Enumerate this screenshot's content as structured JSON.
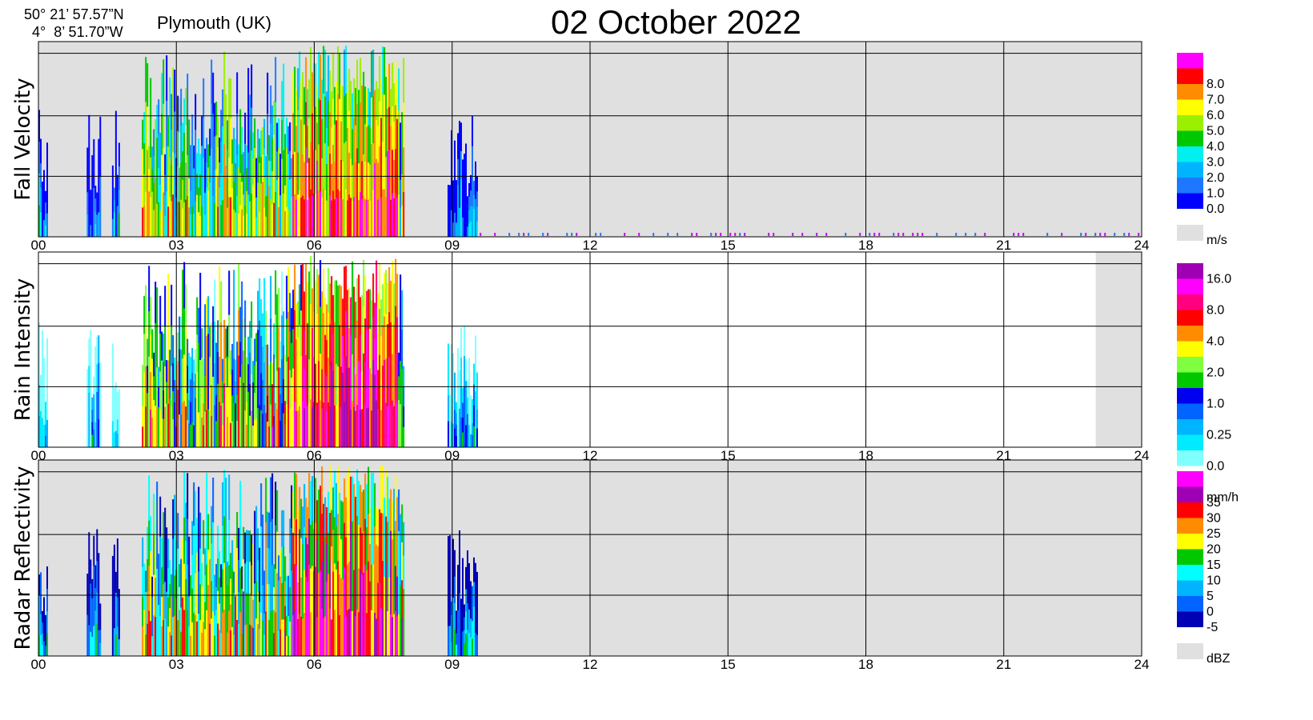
{
  "header": {
    "latitude": "50° 21’ 57.57”N",
    "longitude": "4°  8’ 51.70”W",
    "location": "Plymouth (UK)",
    "date": "02 October  2022"
  },
  "chart_data": [
    {
      "type": "heatmap",
      "ylabel": "Fall Velocity",
      "x_ticks": [
        "00",
        "03",
        "06",
        "09",
        "12",
        "15",
        "18",
        "21",
        "24"
      ],
      "xlim": [
        0,
        24
      ],
      "unit": "m/s",
      "colorbar": [
        {
          "label": "0.0",
          "color": "#0000ff"
        },
        {
          "label": "1.0",
          "color": "#1e78ff"
        },
        {
          "label": "2.0",
          "color": "#00b4ff"
        },
        {
          "label": "3.0",
          "color": "#00f0f0"
        },
        {
          "label": "4.0",
          "color": "#00c800"
        },
        {
          "label": "5.0",
          "color": "#9bef00"
        },
        {
          "label": "6.0",
          "color": "#ffff00"
        },
        {
          "label": "7.0",
          "color": "#ff8c00"
        },
        {
          "label": "8.0",
          "color": "#ff0000"
        },
        {
          "label": "",
          "color": "#ff00ff"
        }
      ],
      "rain_periods_hours": [
        [
          0.0,
          0.2
        ],
        [
          1.05,
          1.35
        ],
        [
          1.6,
          1.75
        ],
        [
          2.25,
          7.95
        ],
        [
          8.9,
          9.55
        ]
      ],
      "no_data_periods_hours": []
    },
    {
      "type": "heatmap",
      "ylabel": "Rain Intensity",
      "x_ticks": [
        "00",
        "03",
        "06",
        "09",
        "12",
        "15",
        "18",
        "21",
        "24"
      ],
      "xlim": [
        0,
        24
      ],
      "unit": "mm/h",
      "colorbar": [
        {
          "label": "0.0",
          "color": "#80ffff"
        },
        {
          "label": "",
          "color": "#00ebff"
        },
        {
          "label": "0.25",
          "color": "#00b4ff"
        },
        {
          "label": "",
          "color": "#0064ff"
        },
        {
          "label": "1.0",
          "color": "#0000f0"
        },
        {
          "label": "",
          "color": "#00c800"
        },
        {
          "label": "2.0",
          "color": "#80ff40"
        },
        {
          "label": "",
          "color": "#ffff00"
        },
        {
          "label": "4.0",
          "color": "#ff8c00"
        },
        {
          "label": "",
          "color": "#ff0000"
        },
        {
          "label": "8.0",
          "color": "#ff0080"
        },
        {
          "label": "",
          "color": "#ff00ff"
        },
        {
          "label": "16.0",
          "color": "#a000b4"
        }
      ],
      "rain_periods_hours": [
        [
          0.0,
          0.2
        ],
        [
          1.05,
          1.35
        ],
        [
          1.6,
          1.75
        ],
        [
          2.25,
          7.95
        ],
        [
          8.9,
          9.55
        ]
      ],
      "no_data_periods_hours": [
        [
          23.0,
          24.0
        ]
      ]
    },
    {
      "type": "heatmap",
      "ylabel": "Radar Reflectivity",
      "x_ticks": [
        "00",
        "03",
        "06",
        "09",
        "12",
        "15",
        "18",
        "21",
        "24"
      ],
      "xlim": [
        0,
        24
      ],
      "unit": "dBZ",
      "colorbar": [
        {
          "label": "-5",
          "color": "#0000b4"
        },
        {
          "label": "0",
          "color": "#0064ff"
        },
        {
          "label": "5",
          "color": "#00b4ff"
        },
        {
          "label": "10",
          "color": "#00ffff"
        },
        {
          "label": "15",
          "color": "#00c800"
        },
        {
          "label": "20",
          "color": "#ffff00"
        },
        {
          "label": "25",
          "color": "#ff8c00"
        },
        {
          "label": "30",
          "color": "#ff0000"
        },
        {
          "label": "35",
          "color": "#a000b4"
        },
        {
          "label": "",
          "color": "#ff00ff"
        }
      ],
      "rain_periods_hours": [
        [
          0.0,
          0.2
        ],
        [
          1.05,
          1.35
        ],
        [
          1.6,
          1.75
        ],
        [
          2.25,
          7.95
        ],
        [
          8.9,
          9.55
        ]
      ],
      "no_data_periods_hours": []
    }
  ]
}
